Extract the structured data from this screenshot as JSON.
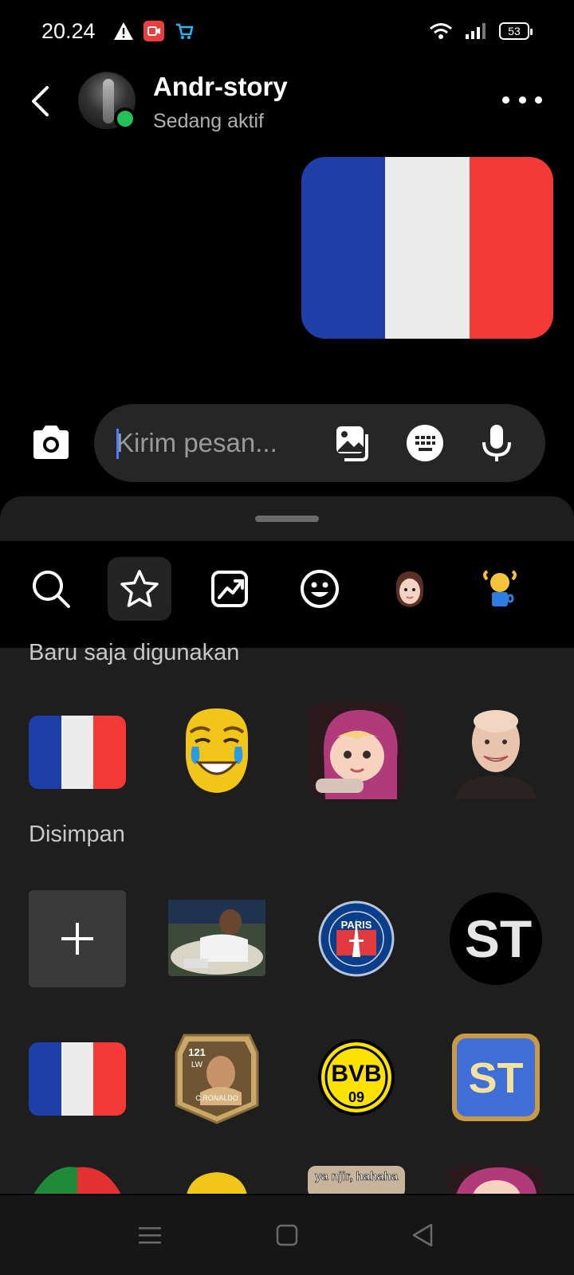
{
  "status_bar": {
    "time": "20.24",
    "battery": "53",
    "icons": [
      "warning-icon",
      "screen-record-icon",
      "shop-icon",
      "wifi-icon",
      "signal-icon",
      "battery-icon"
    ]
  },
  "header": {
    "contact_name": "Andr-story",
    "contact_status": "Sedang aktif",
    "icons": [
      "back-arrow-icon",
      "more-options-icon"
    ]
  },
  "message": {
    "sticker": "france-flag"
  },
  "composer": {
    "placeholder": "Kirim pesan...",
    "value": "",
    "icons": [
      "camera-icon",
      "gallery-icon",
      "sticker-keyboard-icon",
      "microphone-icon"
    ]
  },
  "sticker_panel": {
    "tabs": [
      {
        "name": "search",
        "icon": "search-icon",
        "active": false
      },
      {
        "name": "favorites",
        "icon": "star-icon",
        "active": true
      },
      {
        "name": "trending",
        "icon": "trending-icon",
        "active": false
      },
      {
        "name": "emoji",
        "icon": "smiley-icon",
        "active": false
      },
      {
        "name": "avatar",
        "icon": "avatar-icon",
        "active": false
      },
      {
        "name": "stickers",
        "icon": "sticker-pack-icon",
        "active": false
      }
    ],
    "recent_title": "Baru saja digunakan",
    "saved_title": "Disimpan",
    "recent": [
      "france-flag",
      "crying-laughing-face",
      "cartoon-girl",
      "smiling-boy"
    ],
    "saved_row1": [
      "add",
      "football-player",
      "psg-logo",
      "st-text"
    ],
    "saved_row2": [
      "france-flag",
      "player-card",
      "bvb-logo",
      "st-badge"
    ],
    "bvb_text": "BVB",
    "bvb_sub": "09",
    "st_text": "ST",
    "card_rating": "121",
    "card_position": "LW",
    "card_name": "C.RONALDO",
    "psg_text": "PARIS",
    "partial_caption": "ya njir, hahaha"
  },
  "nav_bar": {
    "icons": [
      "recents-icon",
      "home-icon",
      "back-icon"
    ]
  },
  "colors": {
    "accent": "#4f7cff",
    "online": "#23c15a",
    "flag_blue": "#1e3fa8",
    "flag_white": "#ececec",
    "flag_red": "#f33a36"
  }
}
